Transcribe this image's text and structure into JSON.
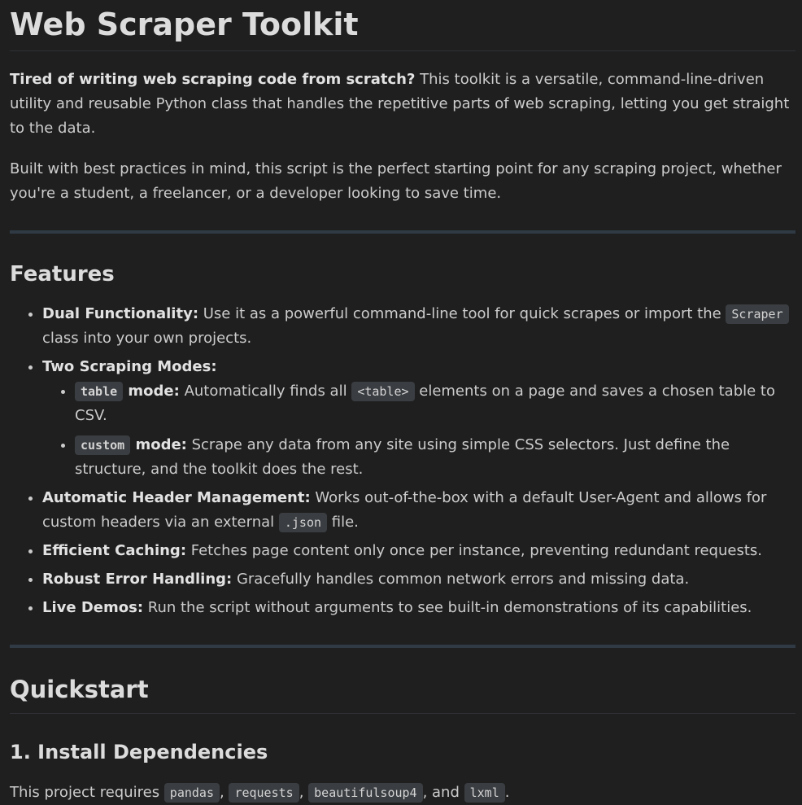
{
  "title": "Web Scraper Toolkit",
  "intro": {
    "lead_bold": "Tired of writing web scraping code from scratch?",
    "lead_rest": " This toolkit is a versatile, command-line-driven utility and reusable Python class that handles the repetitive parts of web scraping, letting you get straight to the data.",
    "second": "Built with best practices in mind, this script is the perfect starting point for any scraping project, whether you're a student, a freelancer, or a developer looking to save time."
  },
  "features": {
    "heading": "Features",
    "dual": {
      "label": "Dual Functionality:",
      "text_before": " Use it as a powerful command-line tool for quick scrapes or import the ",
      "code": "Scraper",
      "text_after": " class into your own projects."
    },
    "modes": {
      "label": "Two Scraping Modes:",
      "table": {
        "code": "table",
        "label": " mode:",
        "text_before": " Automatically finds all ",
        "code2": "<table>",
        "text_after": " elements on a page and saves a chosen table to CSV."
      },
      "custom": {
        "code": "custom",
        "label": " mode:",
        "text": " Scrape any data from any site using simple CSS selectors. Just define the structure, and the toolkit does the rest."
      }
    },
    "headers": {
      "label": "Automatic Header Management:",
      "text_before": " Works out-of-the-box with a default User-Agent and allows for custom headers via an external ",
      "code": ".json",
      "text_after": " file."
    },
    "caching": {
      "label": "Efficient Caching:",
      "text": " Fetches page content only once per instance, preventing redundant requests."
    },
    "errors": {
      "label": "Robust Error Handling:",
      "text": " Gracefully handles common network errors and missing data."
    },
    "demos": {
      "label": "Live Demos:",
      "text": " Run the script without arguments to see built-in demonstrations of its capabilities."
    }
  },
  "quickstart": {
    "heading": "Quickstart",
    "install": {
      "heading": "1. Install Dependencies",
      "text_before": "This project requires ",
      "deps": [
        "pandas",
        "requests",
        "beautifulsoup4",
        "lxml"
      ],
      "sep1": ", ",
      "sep2": ", ",
      "sep3": ", and ",
      "end": "."
    }
  }
}
